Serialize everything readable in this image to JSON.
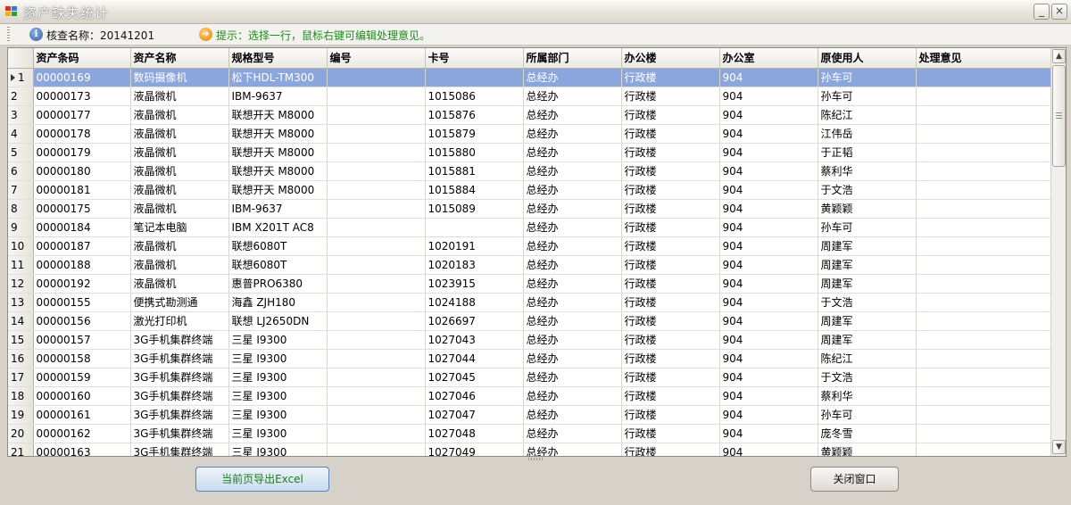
{
  "window": {
    "title": "资产缺失统计",
    "minimize": "_",
    "close": "×"
  },
  "toolbar": {
    "check_name": "核查名称：20141201",
    "hint": "提示：选择一行，鼠标右键可编辑处理意见。"
  },
  "table": {
    "columns": [
      "资产条码",
      "资产名称",
      "规格型号",
      "编号",
      "卡号",
      "所属部门",
      "办公楼",
      "办公室",
      "原使用人",
      "处理意见"
    ],
    "selected_row": 0,
    "rows": [
      [
        "1",
        "00000169",
        "数码摄像机",
        "松下HDL-TM300",
        "",
        "",
        "总经办",
        "行政楼",
        "904",
        "孙车可",
        ""
      ],
      [
        "2",
        "00000173",
        "液晶微机",
        "IBM-9637",
        "",
        "1015086",
        "总经办",
        "行政楼",
        "904",
        "孙车可",
        ""
      ],
      [
        "3",
        "00000177",
        "液晶微机",
        "联想开天 M8000",
        "",
        "1015876",
        "总经办",
        "行政楼",
        "904",
        "陈纪江",
        ""
      ],
      [
        "4",
        "00000178",
        "液晶微机",
        "联想开天 M8000",
        "",
        "1015879",
        "总经办",
        "行政楼",
        "904",
        "江伟岳",
        ""
      ],
      [
        "5",
        "00000179",
        "液晶微机",
        "联想开天 M8000",
        "",
        "1015880",
        "总经办",
        "行政楼",
        "904",
        "于正韬",
        ""
      ],
      [
        "6",
        "00000180",
        "液晶微机",
        "联想开天 M8000",
        "",
        "1015881",
        "总经办",
        "行政楼",
        "904",
        "蔡利华",
        ""
      ],
      [
        "7",
        "00000181",
        "液晶微机",
        "联想开天 M8000",
        "",
        "1015884",
        "总经办",
        "行政楼",
        "904",
        "于文浩",
        ""
      ],
      [
        "8",
        "00000175",
        "液晶微机",
        "IBM-9637",
        "",
        "1015089",
        "总经办",
        "行政楼",
        "904",
        "黄颖颖",
        ""
      ],
      [
        "9",
        "00000184",
        "笔记本电脑",
        "IBM X201T AC8",
        "",
        "",
        "总经办",
        "行政楼",
        "904",
        "孙车可",
        ""
      ],
      [
        "10",
        "00000187",
        "液晶微机",
        "联想6080T",
        "",
        "1020191",
        "总经办",
        "行政楼",
        "904",
        "周建军",
        ""
      ],
      [
        "11",
        "00000188",
        "液晶微机",
        "联想6080T",
        "",
        "1020183",
        "总经办",
        "行政楼",
        "904",
        "周建军",
        ""
      ],
      [
        "12",
        "00000192",
        "液晶微机",
        "惠普PRO6380",
        "",
        "1023915",
        "总经办",
        "行政楼",
        "904",
        "周建军",
        ""
      ],
      [
        "13",
        "00000155",
        "便携式勘测通",
        "海鑫 ZJH180",
        "",
        "1024188",
        "总经办",
        "行政楼",
        "904",
        "于文浩",
        ""
      ],
      [
        "14",
        "00000156",
        "激光打印机",
        "联想 LJ2650DN",
        "",
        "1026697",
        "总经办",
        "行政楼",
        "904",
        "周建军",
        ""
      ],
      [
        "15",
        "00000157",
        "3G手机集群终端",
        "三星 I9300",
        "",
        "1027043",
        "总经办",
        "行政楼",
        "904",
        "周建军",
        ""
      ],
      [
        "16",
        "00000158",
        "3G手机集群终端",
        "三星 I9300",
        "",
        "1027044",
        "总经办",
        "行政楼",
        "904",
        "陈纪江",
        ""
      ],
      [
        "17",
        "00000159",
        "3G手机集群终端",
        "三星 I9300",
        "",
        "1027045",
        "总经办",
        "行政楼",
        "904",
        "于文浩",
        ""
      ],
      [
        "18",
        "00000160",
        "3G手机集群终端",
        "三星 I9300",
        "",
        "1027046",
        "总经办",
        "行政楼",
        "904",
        "蔡利华",
        ""
      ],
      [
        "19",
        "00000161",
        "3G手机集群终端",
        "三星 I9300",
        "",
        "1027047",
        "总经办",
        "行政楼",
        "904",
        "孙车可",
        ""
      ],
      [
        "20",
        "00000162",
        "3G手机集群终端",
        "三星 I9300",
        "",
        "1027048",
        "总经办",
        "行政楼",
        "904",
        "庞冬雪",
        ""
      ],
      [
        "21",
        "00000163",
        "3G手机集群终端",
        "三星 I9300",
        "",
        "1027049",
        "总经办",
        "行政楼",
        "904",
        "黄颖颖",
        ""
      ]
    ]
  },
  "scrollbar": {
    "up": "▲",
    "down": "▼"
  },
  "footer": {
    "export_label": "当前页导出Excel",
    "close_label": "关闭窗口"
  }
}
